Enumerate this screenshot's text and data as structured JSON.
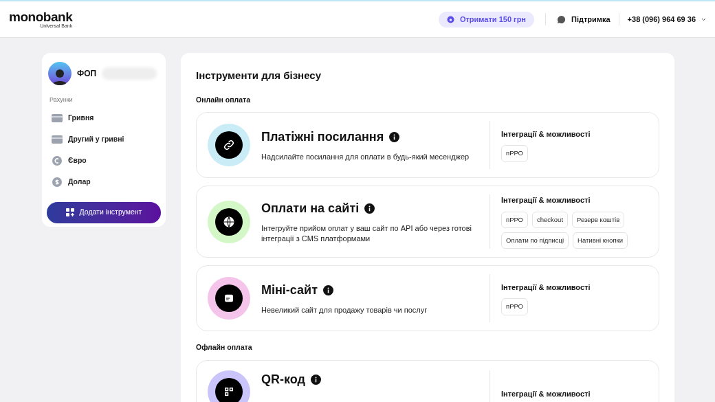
{
  "header": {
    "logo": "monobank",
    "logo_subtitle": "Universal Bank",
    "bonus_button": "Отримати 150 грн",
    "support": "Підтримка",
    "phone": "+38 (096) 964 69 36"
  },
  "sidebar": {
    "profile_prefix": "ФОП",
    "section": "Рахунки",
    "items": [
      {
        "label": "Гривня",
        "kind": "card"
      },
      {
        "label": "Другий у гривні",
        "kind": "card"
      },
      {
        "label": "Євро",
        "kind": "euro"
      },
      {
        "label": "Долар",
        "kind": "dollar"
      }
    ],
    "add_button": "Додати інструмент"
  },
  "main": {
    "title": "Інструменти для бізнесу",
    "sections": [
      {
        "title": "Онлайн оплата",
        "tools": [
          {
            "title": "Платіжні посилання",
            "kind": "link",
            "color": "#c9ecf7",
            "description": "Надсилайте посилання для оплати в будь-який месенджер",
            "features_title": "Інтеграції & можливості",
            "tags": [
              "пРРО"
            ]
          },
          {
            "title": "Оплати на сайті",
            "kind": "globe",
            "color": "#d4f7c8",
            "description": "Інтегруйте прийом оплат у ваш сайт по API або через готові інтеграції з CMS платформами",
            "features_title": "Інтеграції & можливості",
            "tags": [
              "пРРО",
              "checkout",
              "Резерв коштів",
              "Оплати по підписці",
              "Нативні кнопки"
            ]
          },
          {
            "title": "Міні-сайт",
            "kind": "site",
            "color": "#f5c4ea",
            "description": "Невеликий сайт для продажу товарів чи послуг",
            "features_title": "Інтеграції & можливості",
            "tags": [
              "пРРО"
            ]
          }
        ]
      },
      {
        "title": "Офлайн оплата",
        "tools": [
          {
            "title": "QR-код",
            "kind": "qr",
            "color": "#c9c4fa",
            "features_title": "Інтеграції & можливості"
          }
        ]
      }
    ]
  }
}
